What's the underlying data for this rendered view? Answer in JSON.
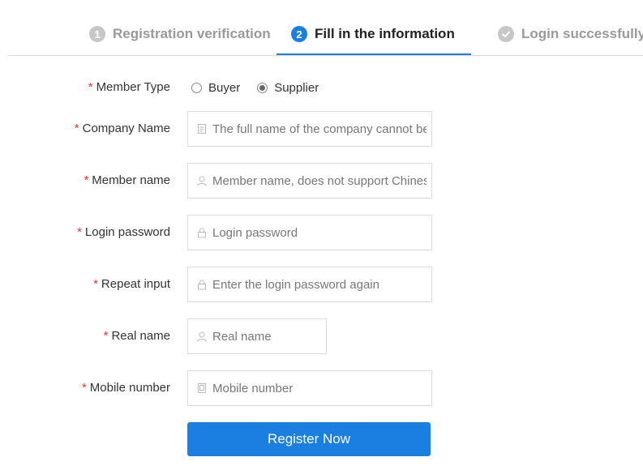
{
  "steps": [
    {
      "number": "1",
      "label": "Registration verification",
      "state": "done"
    },
    {
      "number": "2",
      "label": "Fill in the information",
      "state": "active"
    },
    {
      "number": "",
      "label": "Login successfully",
      "state": "todo"
    }
  ],
  "form": {
    "required_mark": "*",
    "member_type": {
      "label": "Member Type",
      "options": [
        "Buyer",
        "Supplier"
      ],
      "selected": "Supplier"
    },
    "company_name": {
      "label": "Company Name",
      "placeholder": "The full name of the company cannot be empty",
      "icon": "document-icon"
    },
    "member_name": {
      "label": "Member name",
      "placeholder": "Member name, does not support Chinese",
      "icon": "user-icon"
    },
    "login_password": {
      "label": "Login password",
      "placeholder": "Login password",
      "icon": "lock-icon"
    },
    "repeat_input": {
      "label": "Repeat input",
      "placeholder": "Enter the login password again",
      "icon": "lock-icon"
    },
    "real_name": {
      "label": "Real name",
      "placeholder": "Real name",
      "icon": "user-icon"
    },
    "mobile_number": {
      "label": "Mobile number",
      "placeholder": "Mobile number",
      "icon": "phone-icon"
    },
    "submit_label": "Register Now"
  },
  "colors": {
    "accent": "#1a7fe0",
    "required": "#ee3333",
    "inactive_step": "#c7c7c7"
  }
}
